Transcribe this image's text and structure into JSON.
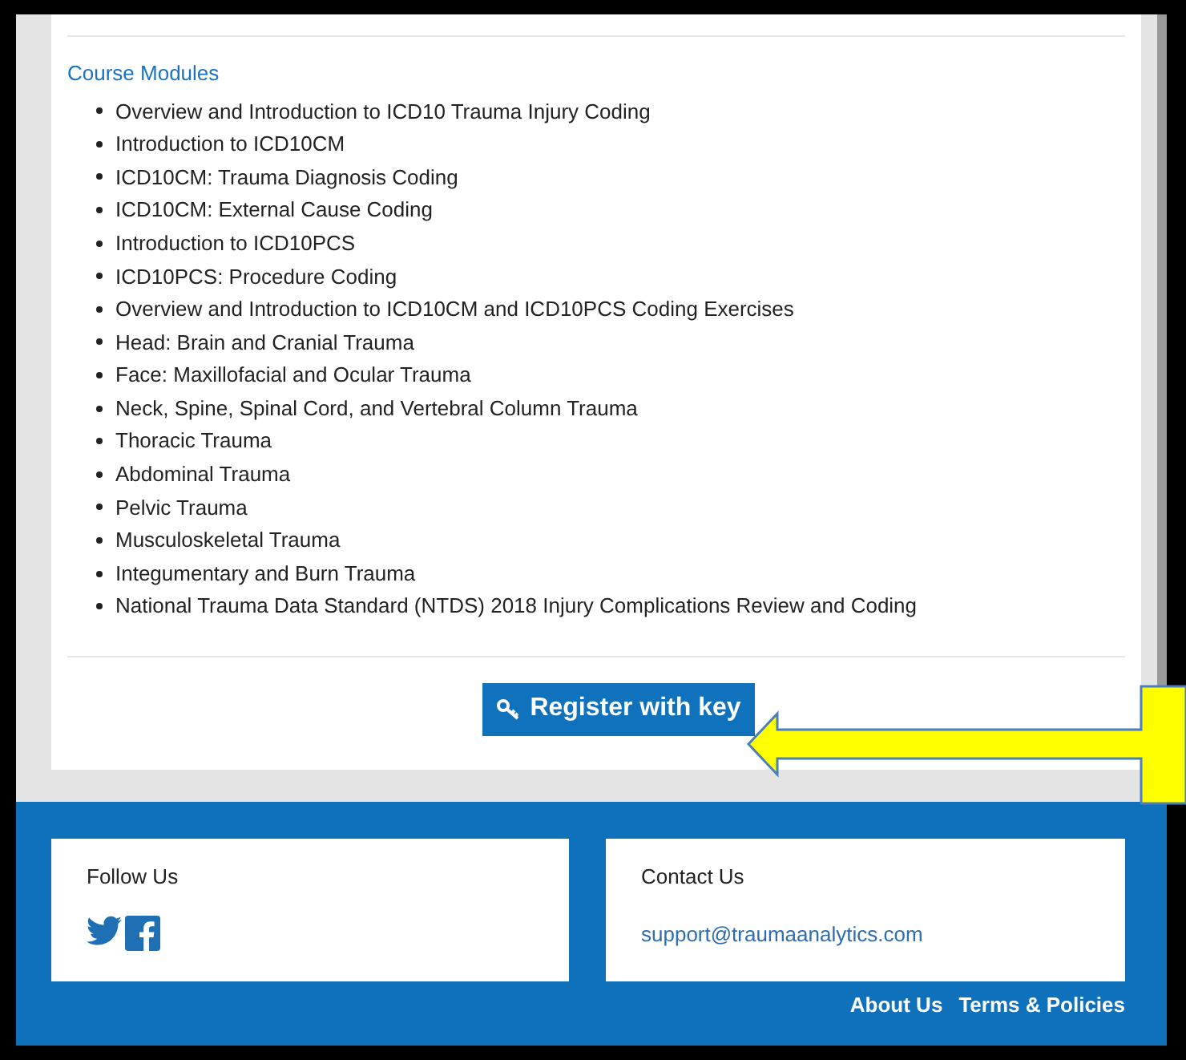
{
  "modules": {
    "heading": "Course Modules",
    "items": [
      "Overview and Introduction to ICD10 Trauma Injury Coding",
      "Introduction to ICD10CM",
      "ICD10CM: Trauma Diagnosis Coding",
      "ICD10CM: External Cause Coding",
      "Introduction to ICD10PCS",
      "ICD10PCS: Procedure Coding",
      "Overview and Introduction to ICD10CM and ICD10PCS Coding Exercises",
      "Head: Brain and Cranial Trauma",
      "Face: Maxillofacial and Ocular Trauma",
      "Neck, Spine, Spinal Cord, and Vertebral Column Trauma",
      "Thoracic Trauma",
      "Abdominal Trauma",
      "Pelvic Trauma",
      "Musculoskeletal Trauma",
      "Integumentary and Burn Trauma",
      "National Trauma Data Standard (NTDS) 2018 Injury Complications Review and Coding"
    ]
  },
  "register_button": "Register with key",
  "footer": {
    "follow": {
      "title": "Follow Us"
    },
    "contact": {
      "title": "Contact Us",
      "email": "support@traumaanalytics.com"
    },
    "links": [
      "About Us",
      "Terms & Policies"
    ]
  }
}
